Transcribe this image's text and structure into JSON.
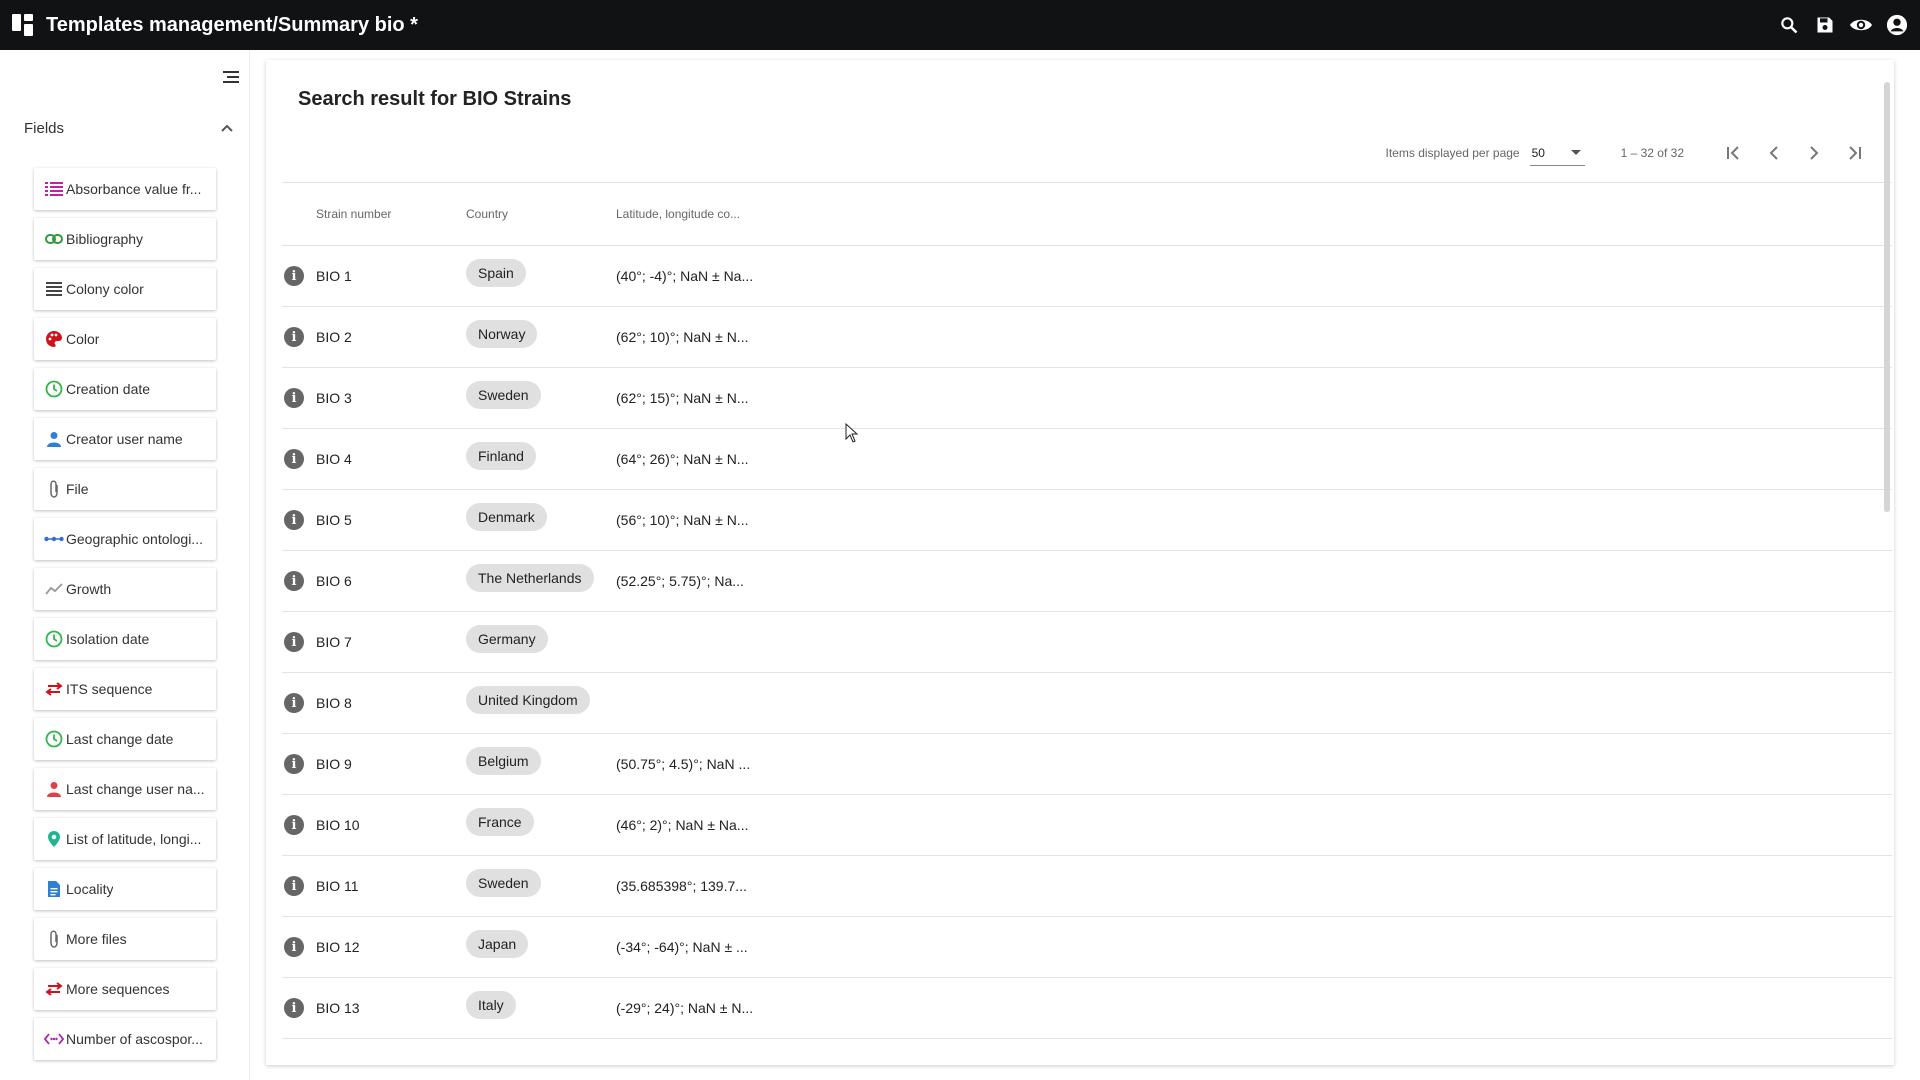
{
  "topbar": {
    "title": "Templates management/Summary bio *",
    "actions": [
      "search-icon",
      "save-icon",
      "eye-icon",
      "account-icon"
    ]
  },
  "sidebar": {
    "section_label": "Fields",
    "fields": [
      {
        "label": "Absorbance value fr...",
        "icon": "list-icon",
        "color": "#c21fa3"
      },
      {
        "label": "Bibliography",
        "icon": "link-icon",
        "color": "#2e9b3a"
      },
      {
        "label": "Colony color",
        "icon": "lines-icon",
        "color": "#444444"
      },
      {
        "label": "Color",
        "icon": "palette-icon",
        "color": "#d0121b"
      },
      {
        "label": "Creation date",
        "icon": "clock-icon",
        "color": "#2eb84a"
      },
      {
        "label": "Creator user name",
        "icon": "person-icon",
        "color": "#2f7fd6"
      },
      {
        "label": "File",
        "icon": "paperclip-icon",
        "color": "#666666"
      },
      {
        "label": "Geographic ontologi...",
        "icon": "dots-icon",
        "color": "#2f6fd6"
      },
      {
        "label": "Growth",
        "icon": "trend-icon",
        "color": "#999999"
      },
      {
        "label": "Isolation date",
        "icon": "clock-icon",
        "color": "#2eb84a"
      },
      {
        "label": "ITS sequence",
        "icon": "swap-icon",
        "color": "#d0121b"
      },
      {
        "label": "Last change date",
        "icon": "clock-icon",
        "color": "#2eb84a"
      },
      {
        "label": "Last change user na...",
        "icon": "person-icon",
        "color": "#e0404a"
      },
      {
        "label": "List of latitude, longi...",
        "icon": "pin-icon",
        "color": "#1fb58f"
      },
      {
        "label": "Locality",
        "icon": "doc-icon",
        "color": "#2f7fd6"
      },
      {
        "label": "More files",
        "icon": "paperclip-icon",
        "color": "#666666"
      },
      {
        "label": "More sequences",
        "icon": "swap-icon",
        "color": "#d0121b"
      },
      {
        "label": "Number of ascospor...",
        "icon": "range-icon",
        "color": "#b01fb0"
      }
    ]
  },
  "main": {
    "heading": "Search result for BIO Strains",
    "paginator": {
      "per_page_label": "Items displayed per page",
      "per_page_value": "50",
      "range": "1 – 32 of 32"
    },
    "columns": [
      "Strain number",
      "Country",
      "Latitude, longitude co..."
    ],
    "rows": [
      {
        "strain": "BIO 1",
        "country": "Spain",
        "lat": "(40°; -4)°; NaN ± Na..."
      },
      {
        "strain": "BIO 2",
        "country": "Norway",
        "lat": "(62°; 10)°; NaN ± N..."
      },
      {
        "strain": "BIO 3",
        "country": "Sweden",
        "lat": "(62°; 15)°; NaN ± N..."
      },
      {
        "strain": "BIO 4",
        "country": "Finland",
        "lat": "(64°; 26)°; NaN ± N..."
      },
      {
        "strain": "BIO 5",
        "country": "Denmark",
        "lat": "(56°; 10)°; NaN ± N..."
      },
      {
        "strain": "BIO 6",
        "country": "The Netherlands",
        "lat": "(52.25°; 5.75)°; Na..."
      },
      {
        "strain": "BIO 7",
        "country": "Germany",
        "lat": ""
      },
      {
        "strain": "BIO 8",
        "country": "United Kingdom",
        "lat": ""
      },
      {
        "strain": "BIO 9",
        "country": "Belgium",
        "lat": "(50.75°; 4.5)°; NaN ..."
      },
      {
        "strain": "BIO 10",
        "country": "France",
        "lat": "(46°; 2)°; NaN ± Na..."
      },
      {
        "strain": "BIO 11",
        "country": "Sweden",
        "lat": "(35.685398°; 139.7..."
      },
      {
        "strain": "BIO 12",
        "country": "Japan",
        "lat": "(-34°; -64)°; NaN ± ..."
      },
      {
        "strain": "BIO 13",
        "country": "Italy",
        "lat": "(-29°; 24)°; NaN ± N..."
      }
    ]
  }
}
